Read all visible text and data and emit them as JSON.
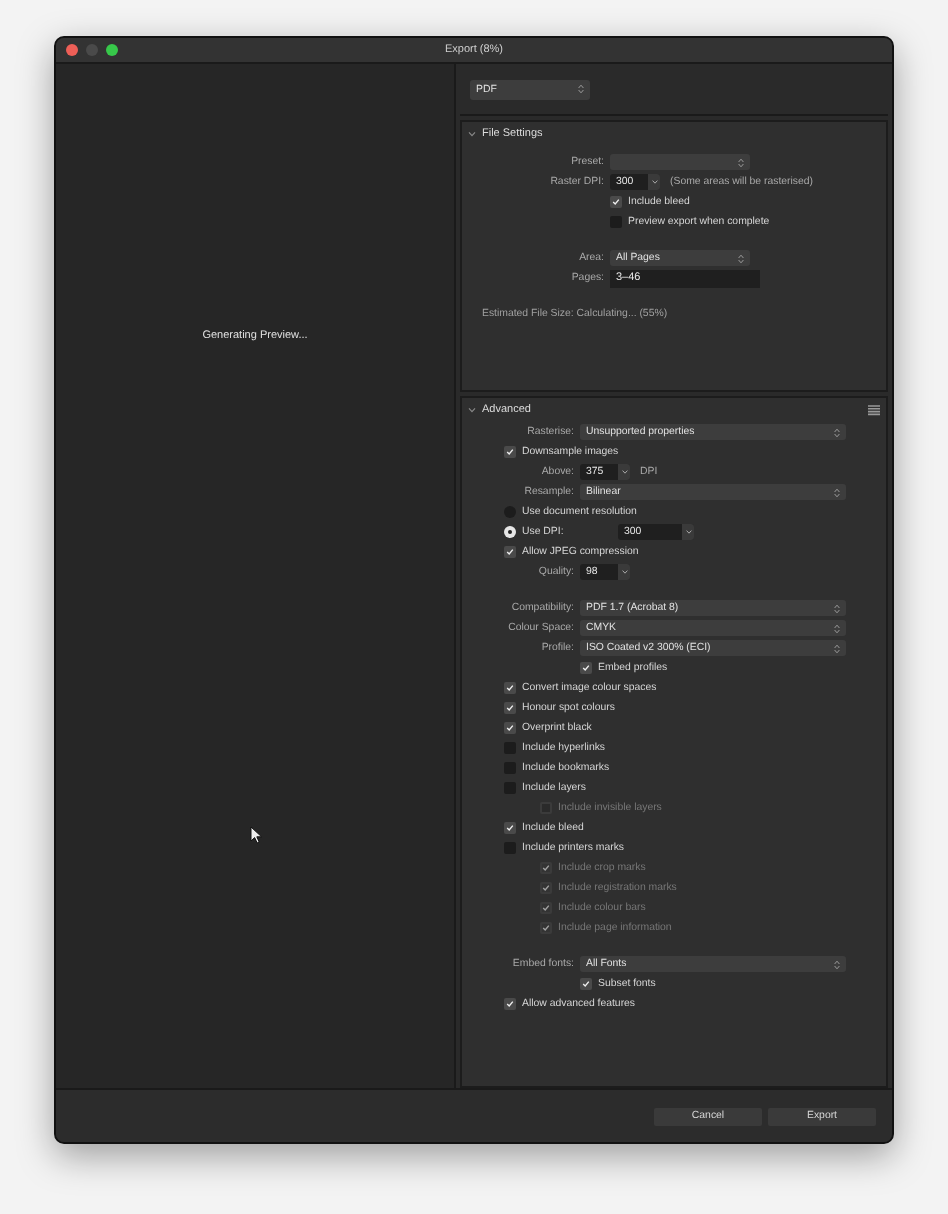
{
  "window": {
    "title": "Export (8%)"
  },
  "preview": {
    "status": "Generating Preview..."
  },
  "format": {
    "value": "PDF"
  },
  "sections": [
    {
      "title": "File Settings",
      "expanded": true,
      "rows": [
        {
          "kind": "select",
          "label": "Preset:"
        },
        {
          "kind": "spin",
          "label": "Raster DPI:",
          "value": "300",
          "note": "(Some areas will be rasterised)",
          "children": [
            {
              "kind": "check",
              "label": "Include bleed",
              "checked": true,
              "disabled": false
            },
            {
              "kind": "check",
              "label": "Preview export when complete",
              "checked": false,
              "disabled": false
            }
          ]
        },
        {
          "kind": "select",
          "label": "Area:",
          "value": "All Pages",
          "gap_before": true
        },
        {
          "kind": "text",
          "label": "Pages:",
          "value": "3–46"
        },
        {
          "kind": "info",
          "text": "Estimated File Size: Calculating... (55%)",
          "gap_before": true
        }
      ]
    },
    {
      "title": "Advanced",
      "expanded": true,
      "menu": true,
      "rows": [
        {
          "kind": "select",
          "label": "Rasterise:",
          "value": "Unsupported properties"
        },
        {
          "kind": "check",
          "label": "Downsample images",
          "checked": true,
          "disabled": false
        },
        {
          "kind": "spin",
          "label": "Above:",
          "value": "375",
          "unit": "DPI"
        },
        {
          "kind": "select",
          "label": "Resample:",
          "value": "Bilinear"
        },
        {
          "kind": "radio",
          "label": "Use document resolution",
          "selected": false
        },
        {
          "kind": "radio",
          "label": "Use DPI:",
          "selected": true,
          "value": "300"
        },
        {
          "kind": "check",
          "label": "Allow JPEG compression",
          "checked": true,
          "disabled": false
        },
        {
          "kind": "spin",
          "label": "Quality:",
          "value": "98"
        },
        {
          "kind": "select",
          "label": "Compatibility:",
          "value": "PDF 1.7 (Acrobat 8)",
          "gap_before": true
        },
        {
          "kind": "select",
          "label": "Colour Space:",
          "value": "CMYK"
        },
        {
          "kind": "select",
          "label": "Profile:",
          "value": "ISO Coated v2 300% (ECI)",
          "children": [
            {
              "kind": "check",
              "label": "Embed profiles",
              "checked": true,
              "disabled": false
            }
          ]
        },
        {
          "kind": "check",
          "label": "Convert image colour spaces",
          "checked": true,
          "disabled": false
        },
        {
          "kind": "check",
          "label": "Honour spot colours",
          "checked": true,
          "disabled": false
        },
        {
          "kind": "check",
          "label": "Overprint black",
          "checked": true,
          "disabled": false
        },
        {
          "kind": "check",
          "label": "Include hyperlinks",
          "checked": false,
          "disabled": false
        },
        {
          "kind": "check",
          "label": "Include bookmarks",
          "checked": false,
          "disabled": false
        },
        {
          "kind": "check",
          "label": "Include layers",
          "checked": false,
          "disabled": false,
          "children": [
            {
              "kind": "check",
              "label": "Include invisible layers",
              "checked": false,
              "disabled": true
            }
          ]
        },
        {
          "kind": "check",
          "label": "Include bleed",
          "checked": true,
          "disabled": false
        },
        {
          "kind": "check",
          "label": "Include printers marks",
          "checked": false,
          "disabled": false,
          "children": [
            {
              "kind": "check",
              "label": "Include crop marks",
              "checked": true,
              "disabled": true
            },
            {
              "kind": "check",
              "label": "Include registration marks",
              "checked": true,
              "disabled": true
            },
            {
              "kind": "check",
              "label": "Include colour bars",
              "checked": true,
              "disabled": true
            },
            {
              "kind": "check",
              "label": "Include page information",
              "checked": true,
              "disabled": true
            }
          ]
        },
        {
          "kind": "select",
          "label": "Embed fonts:",
          "value": "All Fonts",
          "gap_before": true,
          "children": [
            {
              "kind": "check",
              "label": "Subset fonts",
              "checked": true,
              "disabled": false
            }
          ]
        },
        {
          "kind": "check",
          "label": "Allow advanced features",
          "checked": true,
          "disabled": false
        }
      ]
    }
  ],
  "footer": {
    "buttons": [
      "Cancel",
      "Export"
    ]
  }
}
